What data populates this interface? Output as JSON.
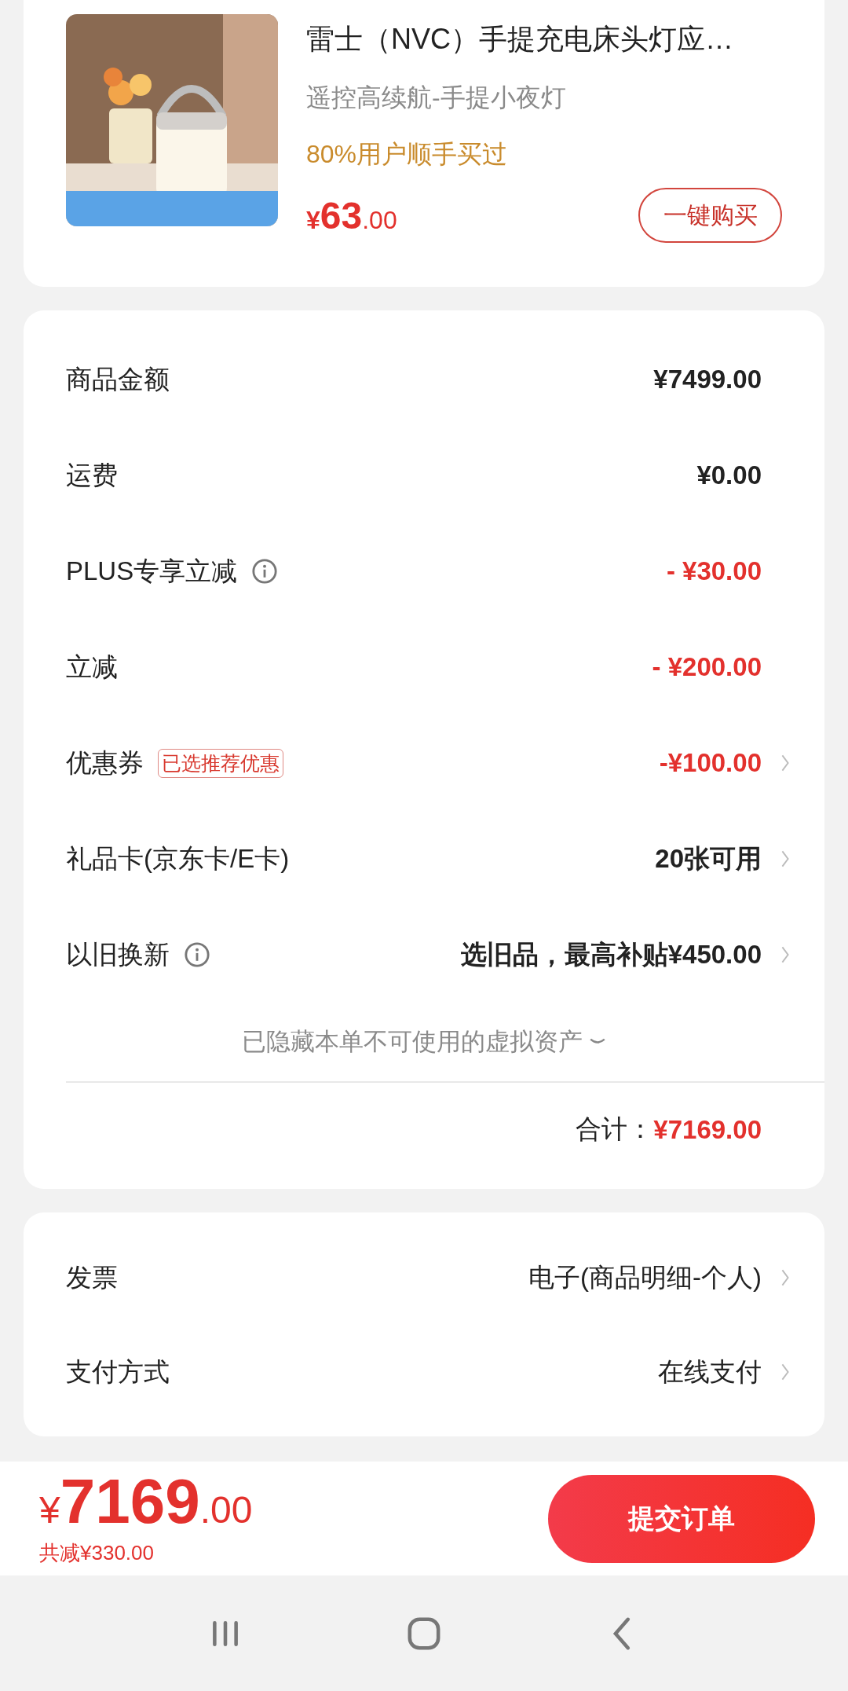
{
  "product": {
    "title": "雷士（NVC）手提充电床头灯应…",
    "subtitle": "遥控高续航-手提小夜灯",
    "social_proof": "80%用户顺手买过",
    "price": {
      "symbol": "¥",
      "integer": "63",
      "decimal": ".00"
    },
    "buy_button": "一键购买"
  },
  "summary": {
    "rows": [
      {
        "label": "商品金额",
        "value": "¥7499.00",
        "discount": false,
        "info": false,
        "chevron": false
      },
      {
        "label": "运费",
        "value": "¥0.00",
        "discount": false,
        "info": false,
        "chevron": false
      },
      {
        "label": "PLUS专享立减",
        "value": "- ¥30.00",
        "discount": true,
        "info": true,
        "chevron": false
      },
      {
        "label": "立减",
        "value": "- ¥200.00",
        "discount": true,
        "info": false,
        "chevron": false
      },
      {
        "label": "优惠券",
        "tag": "已选推荐优惠",
        "value": "-¥100.00",
        "discount": true,
        "info": false,
        "chevron": true
      },
      {
        "label": "礼品卡(京东卡/E卡)",
        "value": "20张可用",
        "discount": false,
        "info": false,
        "chevron": true
      },
      {
        "label": "以旧换新",
        "value": "选旧品，最高补贴¥450.00",
        "discount": false,
        "info": true,
        "chevron": true
      }
    ],
    "hidden_note": "已隐藏本单不可使用的虚拟资产",
    "total": {
      "label": "合计：",
      "value": "¥7169.00"
    }
  },
  "options": [
    {
      "label": "发票",
      "value": "电子(商品明细-个人)",
      "chevron": true
    },
    {
      "label": "支付方式",
      "value": "在线支付",
      "chevron": true
    }
  ],
  "checkout": {
    "symbol": "¥",
    "integer": "7169",
    "decimal": ".00",
    "saved": "共减¥330.00",
    "submit": "提交订单"
  }
}
